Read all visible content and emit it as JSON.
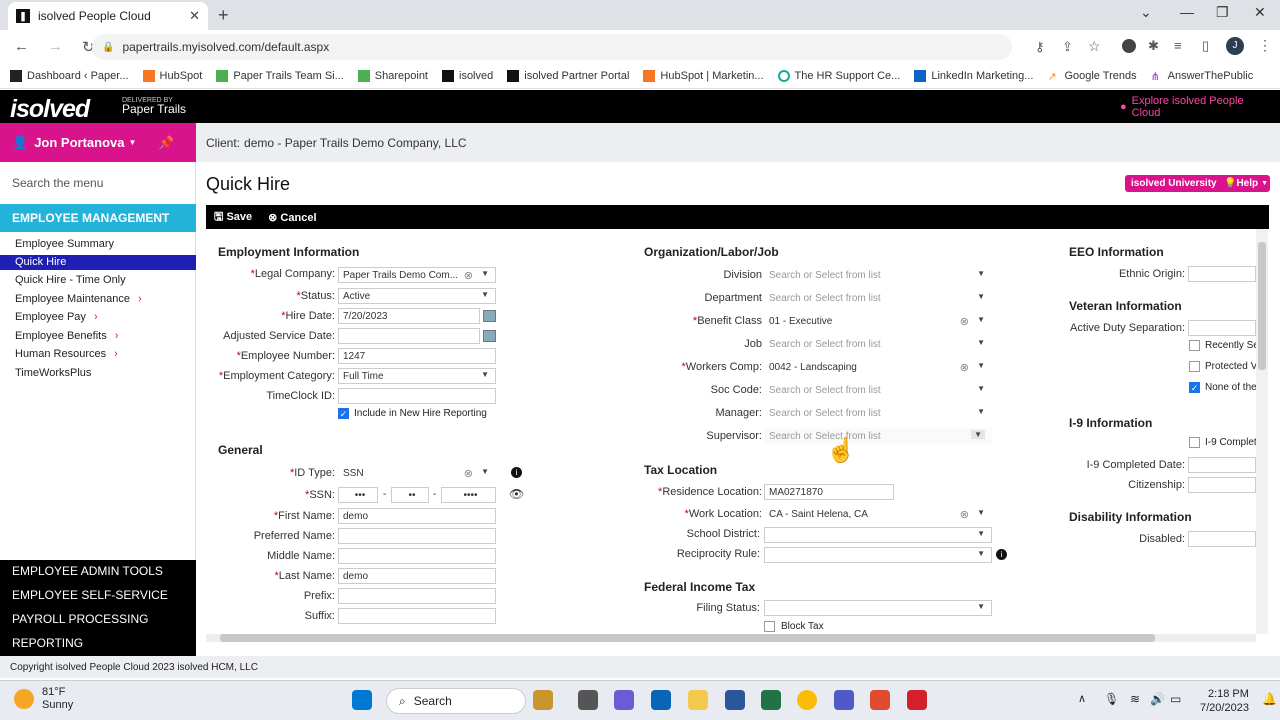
{
  "browser": {
    "tab_title": "isolved People Cloud",
    "url": "papertrails.myisolved.com/default.aspx",
    "profile_initial": "J",
    "bookmarks": [
      "Dashboard ‹ Paper...",
      "HubSpot",
      "Paper Trails Team Si...",
      "Sharepoint",
      "isolved",
      "isolved Partner Portal",
      "HubSpot | Marketin...",
      "The HR Support Ce...",
      "LinkedIn Marketing...",
      "Google Trends",
      "AnswerThePublic"
    ]
  },
  "header": {
    "logo": "isolved",
    "delivered_by": "DELIVERED BY",
    "partner": "Paper Trails",
    "explore": "Explore isolved People Cloud"
  },
  "user": {
    "name": "Jon Portanova"
  },
  "sidebar": {
    "search_placeholder": "Search the menu",
    "section": "EMPLOYEE MANAGEMENT",
    "items": [
      "Employee Summary",
      "Quick Hire",
      "Quick Hire - Time Only",
      "Employee Maintenance",
      "Employee Pay",
      "Employee Benefits",
      "Human Resources",
      "TimeWorksPlus"
    ],
    "bottom": [
      "EMPLOYEE ADMIN TOOLS",
      "EMPLOYEE SELF-SERVICE",
      "PAYROLL PROCESSING",
      "REPORTING"
    ]
  },
  "client": {
    "label": "Client:",
    "value": "demo - Paper Trails Demo Company, LLC"
  },
  "page": {
    "title": "Quick Hire",
    "university": "isolved University",
    "help": "Help"
  },
  "toolbar": {
    "save": "Save",
    "cancel": "Cancel"
  },
  "employment": {
    "title": "Employment Information",
    "legal_company_label": "Legal Company:",
    "legal_company": "Paper Trails Demo Com...",
    "status_label": "Status:",
    "status": "Active",
    "hire_date_label": "Hire Date:",
    "hire_date": "7/20/2023",
    "adjusted_label": "Adjusted Service Date:",
    "emp_number_label": "Employee Number:",
    "emp_number": "1247",
    "emp_category_label": "Employment Category:",
    "emp_category": "Full Time",
    "timeclock_label": "TimeClock ID:",
    "new_hire_label": "Include in New Hire Reporting"
  },
  "general": {
    "title": "General",
    "id_type_label": "ID Type:",
    "id_type": "SSN",
    "ssn_label": "SSN:",
    "ssn_a": "•••",
    "ssn_b": "••",
    "ssn_c": "••••",
    "first_label": "First Name:",
    "first": "demo",
    "preferred_label": "Preferred Name:",
    "middle_label": "Middle Name:",
    "last_label": "Last Name:",
    "last": "demo",
    "prefix_label": "Prefix:",
    "suffix_label": "Suffix:"
  },
  "org": {
    "title": "Organization/Labor/Job",
    "placeholder": "Search or Select from list",
    "division_label": "Division",
    "department_label": "Department",
    "benefit_label": "Benefit Class",
    "benefit": "01 - Executive",
    "job_label": "Job",
    "workers_label": "Workers Comp:",
    "workers": "0042 - Landscaping",
    "soc_label": "Soc Code:",
    "manager_label": "Manager:",
    "supervisor_label": "Supervisor:"
  },
  "tax": {
    "title": "Tax Location",
    "residence_label": "Residence Location:",
    "residence": "MA0271870",
    "work_label": "Work Location:",
    "work": "CA - Saint Helena, CA",
    "school_label": "School District:",
    "reciprocity_label": "Reciprocity Rule:"
  },
  "fit": {
    "title": "Federal Income Tax",
    "filing_label": "Filing Status:",
    "block_label": "Block Tax"
  },
  "eeo": {
    "title": "EEO Information",
    "ethnic_label": "Ethnic Origin:"
  },
  "veteran": {
    "title": "Veteran Information",
    "active_label": "Active Duty Separation:",
    "opt1": "Recently Se",
    "opt2": "Protected V",
    "opt3": "None of the"
  },
  "i9": {
    "title": "I-9 Information",
    "complete_label": "I-9 Complet",
    "date_label": "I-9 Completed Date:",
    "citizenship_label": "Citizenship:"
  },
  "disability": {
    "title": "Disability Information",
    "disabled_label": "Disabled:"
  },
  "footer": "Copyright isolved People Cloud 2023 isolved HCM, LLC",
  "taskbar": {
    "temp": "81°F",
    "weather": "Sunny",
    "search": "Search",
    "time": "2:18 PM",
    "date": "7/20/2023"
  }
}
